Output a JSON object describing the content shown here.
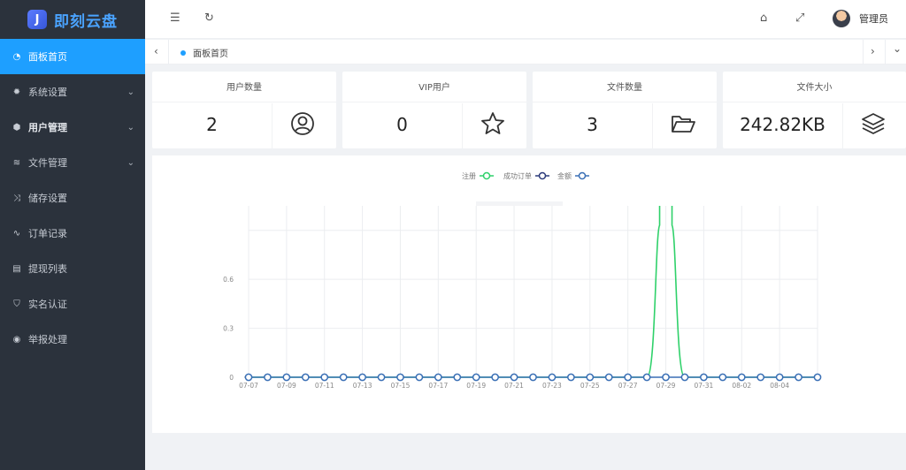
{
  "logo": {
    "mark": "J",
    "text": "即刻云盘"
  },
  "sidebar": {
    "items": [
      {
        "label": "面板首页",
        "icon": "dashboard-icon",
        "glyph": "◔",
        "active": true,
        "chevron": false,
        "bold": false
      },
      {
        "label": "系统设置",
        "icon": "gear-icon",
        "glyph": "✹",
        "active": false,
        "chevron": true,
        "bold": false
      },
      {
        "label": "用户管理",
        "icon": "cube-icon",
        "glyph": "⬢",
        "active": false,
        "chevron": true,
        "bold": true
      },
      {
        "label": "文件管理",
        "icon": "layers-icon",
        "glyph": "≋",
        "active": false,
        "chevron": true,
        "bold": false
      },
      {
        "label": "储存设置",
        "icon": "shuffle-icon",
        "glyph": "⤨",
        "active": false,
        "chevron": false,
        "bold": false
      },
      {
        "label": "订单记录",
        "icon": "pulse-icon",
        "glyph": "∿",
        "active": false,
        "chevron": false,
        "bold": false
      },
      {
        "label": "提现列表",
        "icon": "list-icon",
        "glyph": "▤",
        "active": false,
        "chevron": false,
        "bold": false
      },
      {
        "label": "实名认证",
        "icon": "shield-icon",
        "glyph": "⛉",
        "active": false,
        "chevron": false,
        "bold": false
      },
      {
        "label": "举报处理",
        "icon": "circle-play-icon",
        "glyph": "◉",
        "active": false,
        "chevron": false,
        "bold": false
      }
    ]
  },
  "header": {
    "menu_glyph": "☰",
    "refresh_glyph": "↻",
    "home_glyph": "⌂",
    "fullscreen_glyph": "⤢",
    "user_name": "管理员"
  },
  "tabs": {
    "left_arrow": "‹",
    "right_arrow": "›",
    "dropdown": "⌄",
    "home_label": "面板首页"
  },
  "cards": [
    {
      "title": "用户数量",
      "value": "2",
      "icon": "user-circle-icon"
    },
    {
      "title": "VIP用户",
      "value": "0",
      "icon": "star-icon"
    },
    {
      "title": "文件数量",
      "value": "3",
      "icon": "folder-open-icon"
    },
    {
      "title": "文件大小",
      "value": "242.82KB",
      "icon": "stack-icon"
    }
  ],
  "chart_data": {
    "type": "line",
    "legend": [
      {
        "name": "注册",
        "color": "#2fd16a"
      },
      {
        "name": "成功订单",
        "color": "#2b3a7a"
      },
      {
        "name": "金额",
        "color": "#3a6fb5"
      }
    ],
    "x": [
      "07-07",
      "07-08",
      "07-09",
      "07-10",
      "07-11",
      "07-12",
      "07-13",
      "07-14",
      "07-15",
      "07-16",
      "07-17",
      "07-18",
      "07-19",
      "07-20",
      "07-21",
      "07-22",
      "07-23",
      "07-24",
      "07-25",
      "07-26",
      "07-27",
      "07-28",
      "07-29",
      "07-30",
      "07-31",
      "08-01",
      "08-02",
      "08-03",
      "08-04",
      "08-05",
      "08-06"
    ],
    "x_tick_labels": [
      "07-07",
      "07-09",
      "07-11",
      "07-13",
      "07-15",
      "07-17",
      "07-19",
      "07-21",
      "07-23",
      "07-25",
      "07-27",
      "07-29",
      "07-31",
      "08-02",
      "08-04"
    ],
    "y_tick_labels": [
      "0",
      "0.3",
      "0.6"
    ],
    "ylim": [
      0,
      1.05
    ],
    "series": [
      {
        "name": "注册",
        "values": [
          0,
          0,
          0,
          0,
          0,
          0,
          0,
          0,
          0,
          0,
          0,
          0,
          0,
          0,
          0,
          0,
          0,
          0,
          0,
          0,
          0,
          0,
          2,
          0,
          0,
          0,
          0,
          0,
          0,
          0,
          0
        ]
      },
      {
        "name": "成功订单",
        "values": [
          0,
          0,
          0,
          0,
          0,
          0,
          0,
          0,
          0,
          0,
          0,
          0,
          0,
          0,
          0,
          0,
          0,
          0,
          0,
          0,
          0,
          0,
          0,
          0,
          0,
          0,
          0,
          0,
          0,
          0,
          0
        ]
      },
      {
        "name": "金额",
        "values": [
          0,
          0,
          0,
          0,
          0,
          0,
          0,
          0,
          0,
          0,
          0,
          0,
          0,
          0,
          0,
          0,
          0,
          0,
          0,
          0,
          0,
          0,
          0,
          0,
          0,
          0,
          0,
          0,
          0,
          0,
          0
        ]
      }
    ],
    "grid": true
  }
}
